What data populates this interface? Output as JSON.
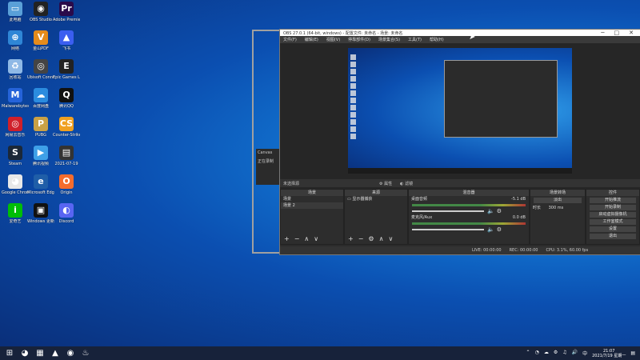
{
  "desktop_icons": [
    {
      "label": "此电脑",
      "icon": "pc-icon",
      "color": "#5aa0d8",
      "glyph": "▭"
    },
    {
      "label": "OBS Studio",
      "icon": "obs-icon",
      "color": "#222222",
      "glyph": "◉"
    },
    {
      "label": "Adobe Premiere Pro",
      "icon": "premiere-icon",
      "color": "#2a0a4a",
      "glyph": "Pr"
    },
    {
      "label": "网络",
      "icon": "network-icon",
      "color": "#2f86d6",
      "glyph": "⊕"
    },
    {
      "label": "金山PDF",
      "icon": "pdf-icon",
      "color": "#e58b1b",
      "glyph": "V"
    },
    {
      "label": "飞书",
      "icon": "feishu-icon",
      "color": "#3b5ef0",
      "glyph": "▲"
    },
    {
      "label": "回收站",
      "icon": "recycle-bin-icon",
      "color": "#8fb9e6",
      "glyph": "♻"
    },
    {
      "label": "Ubisoft Connect",
      "icon": "ubisoft-icon",
      "color": "#444444",
      "glyph": "◎"
    },
    {
      "label": "Epic Games Launcher",
      "icon": "epic-icon",
      "color": "#222222",
      "glyph": "E"
    },
    {
      "label": "Malwarebytes",
      "icon": "malware-icon",
      "color": "#2563d9",
      "glyph": "M"
    },
    {
      "label": "百度网盘",
      "icon": "baidu-pan-icon",
      "color": "#2b8cdf",
      "glyph": "☁"
    },
    {
      "label": "腾讯QQ",
      "icon": "qq-icon",
      "color": "#111111",
      "glyph": "Q"
    },
    {
      "label": "网易云音乐",
      "icon": "netease-music-icon",
      "color": "#d0202a",
      "glyph": "◎"
    },
    {
      "label": "PUBG",
      "icon": "pubg-icon",
      "color": "#caa145",
      "glyph": "P"
    },
    {
      "label": "Counter-Strike",
      "icon": "cs-icon",
      "color": "#f0a020",
      "glyph": "CS"
    },
    {
      "label": "Steam",
      "icon": "steam-icon",
      "color": "#1b2838",
      "glyph": "S"
    },
    {
      "label": "腾讯视频",
      "icon": "tencent-video-icon",
      "color": "#3ea0e8",
      "glyph": "▶"
    },
    {
      "label": "2021-07-19",
      "icon": "file-icon",
      "color": "#333333",
      "glyph": "▤"
    },
    {
      "label": "Google Chrome",
      "icon": "chrome-icon",
      "color": "#e8e8e8",
      "glyph": "◕"
    },
    {
      "label": "Microsoft Edge",
      "icon": "edge-icon",
      "color": "#1f5ea8",
      "glyph": "e"
    },
    {
      "label": "Origin",
      "icon": "origin-icon",
      "color": "#f56c2d",
      "glyph": "O"
    },
    {
      "label": "爱奇艺",
      "icon": "iqiyi-icon",
      "color": "#00be06",
      "glyph": "i"
    },
    {
      "label": "Windows 更新",
      "icon": "windows-update-icon",
      "color": "#111111",
      "glyph": "▣"
    },
    {
      "label": "Discord",
      "icon": "discord-icon",
      "color": "#5865f2",
      "glyph": "◐"
    }
  ],
  "obs": {
    "title": "OBS 27.0.1 (64-bit, windows) - 配置文件: 未命名 - 场景: 未命名",
    "menu": [
      "文件(F)",
      "编辑(E)",
      "视图(V)",
      "停靠部件(D)",
      "场景集合(S)",
      "工具(T)",
      "帮助(H)"
    ],
    "no_source_selected": "未选择源",
    "properties_btn": "属性",
    "filters_btn": "滤镜",
    "docks": {
      "scenes": {
        "title": "场景",
        "items": [
          "场景",
          "场景 2"
        ]
      },
      "sources": {
        "title": "来源",
        "items": [
          "显示器捕获"
        ]
      },
      "mixer": {
        "title": "混音器",
        "ch1": "桌面音频",
        "ch1_db": "-5.1 dB",
        "ch2": "麦克风/Aux",
        "ch2_db": "0.0 dB"
      },
      "transitions": {
        "title": "场景转场",
        "fade": "淡出",
        "duration_label": "时长",
        "duration": "300 ms"
      },
      "controls": {
        "title": "控件",
        "buttons": [
          "开始推流",
          "开始录制",
          "启动虚拟摄像机",
          "工作室模式",
          "设置",
          "退出"
        ]
      }
    },
    "status": [
      "LIVE: 00:00:00",
      "REC: 00:00:00",
      "CPU: 3.1%, 60.00 fps"
    ]
  },
  "popup": {
    "line1": "Canvas",
    "line2": "正在录制"
  },
  "taskbar": {
    "items": [
      {
        "icon": "windows-start-icon",
        "glyph": "⊞"
      },
      {
        "icon": "chrome-taskbar-icon",
        "glyph": "◕"
      },
      {
        "icon": "explorer-taskbar-icon",
        "glyph": "▦"
      },
      {
        "icon": "feishu-taskbar-icon",
        "glyph": "▲"
      },
      {
        "icon": "obs-taskbar-icon",
        "glyph": "◉"
      },
      {
        "icon": "steam-taskbar-icon",
        "glyph": "♨"
      }
    ],
    "tray_glyphs": [
      "⌃",
      "◔",
      "☁",
      "⚙",
      "♫",
      "🔊",
      "中"
    ],
    "time": "21:07",
    "date": "2021/7/19 星期一"
  }
}
